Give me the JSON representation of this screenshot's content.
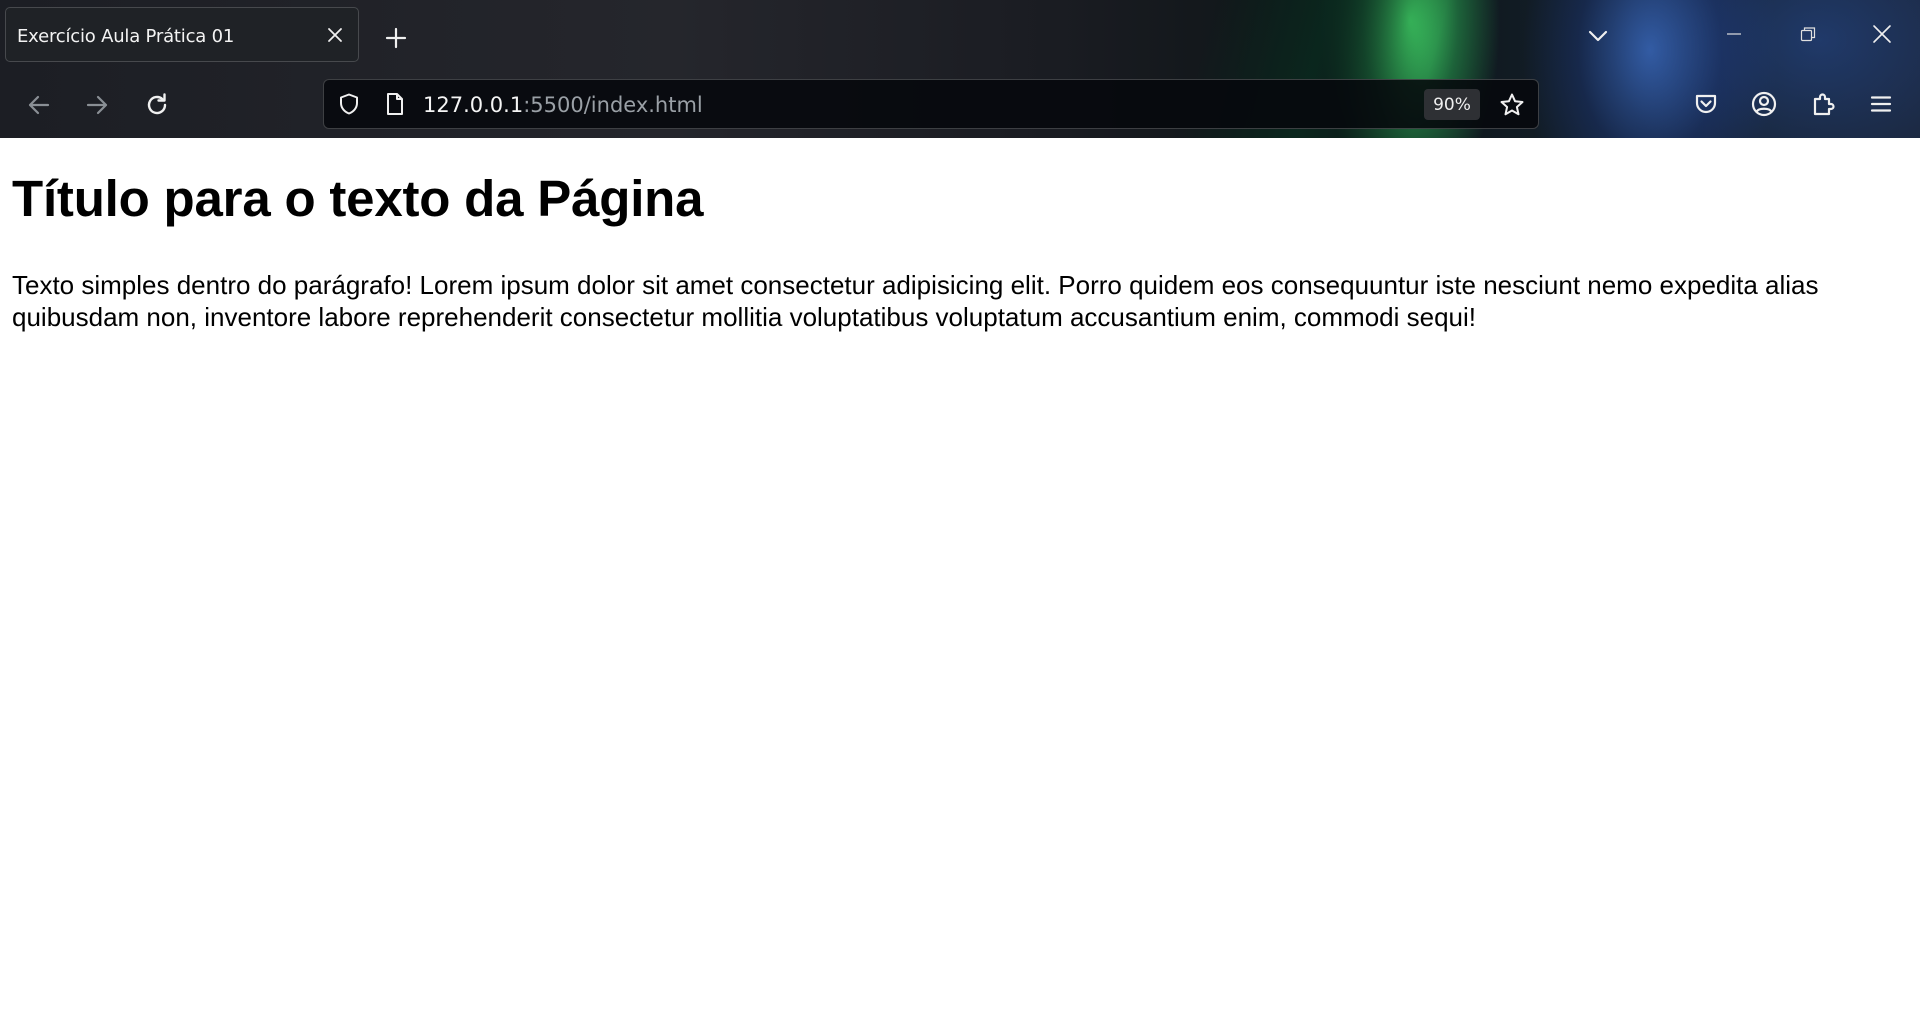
{
  "browser": {
    "tab": {
      "title": "Exercício Aula Prática 01"
    },
    "urlbar": {
      "host": "127.0.0.1",
      "path": ":5500/index.html",
      "zoom": "90%"
    }
  },
  "page": {
    "heading": "Título para o texto da Página",
    "paragraph": "Texto simples dentro do parágrafo! Lorem ipsum dolor sit amet consectetur adipisicing elit. Porro quidem eos consequuntur iste nesciunt nemo expedita alias quibusdam non, inventore labore reprehenderit consectetur mollitia voluptatibus voluptatum accusantium enim, commodi sequi!"
  },
  "icons": {
    "tab_close": "close-icon",
    "new_tab": "plus-icon",
    "list_tabs": "chevron-down-icon",
    "minimize": "minimize-icon",
    "restore": "restore-icon",
    "window_close": "close-icon",
    "back": "arrow-left-icon",
    "forward": "arrow-right-icon",
    "reload": "reload-icon",
    "tracking_protection": "shield-icon",
    "page_info": "page-icon",
    "bookmark": "star-icon",
    "pocket": "pocket-icon",
    "account": "account-icon",
    "extensions": "puzzle-icon",
    "menu": "hamburger-icon"
  },
  "colors": {
    "chrome_bg": "#1c1e24",
    "tab_bg": "#1f2226",
    "url_path": "#9aa0a6",
    "page_bg": "#ffffff",
    "text": "#000000"
  }
}
